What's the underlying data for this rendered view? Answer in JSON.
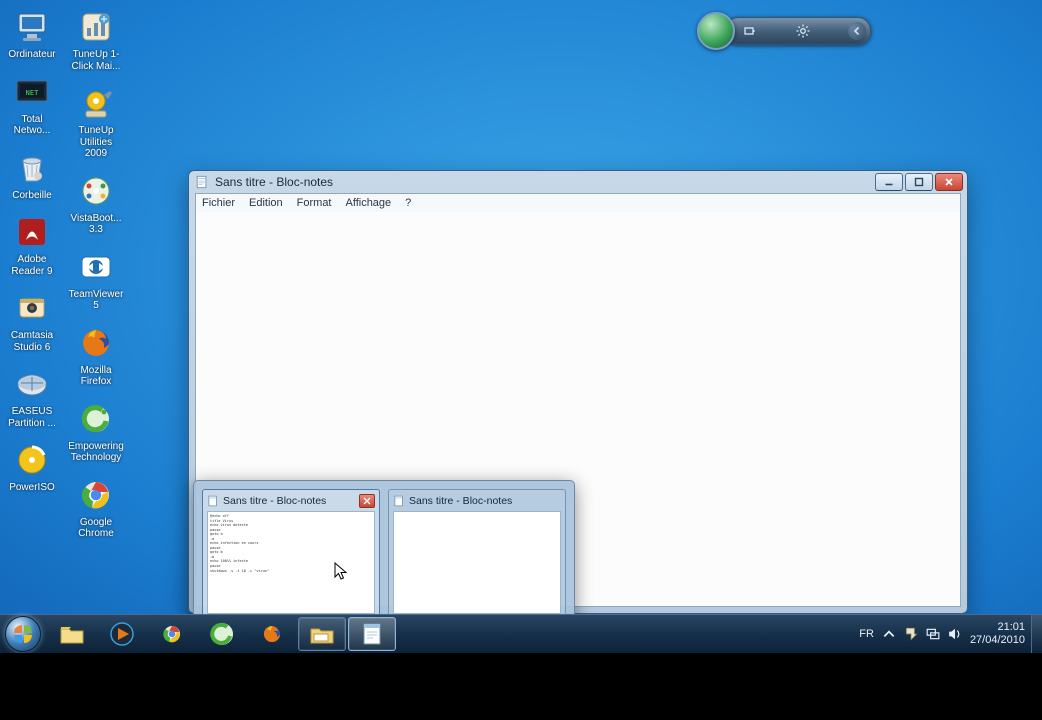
{
  "desktop": {
    "cols": [
      [
        {
          "id": "computer",
          "label": "Ordinateur"
        },
        {
          "id": "total-networ",
          "label": "Total Netwo..."
        },
        {
          "id": "recycle-bin",
          "label": "Corbeille"
        },
        {
          "id": "adobe-reader",
          "label": "Adobe Reader 9"
        },
        {
          "id": "camtasia",
          "label": "Camtasia Studio 6"
        },
        {
          "id": "easeus",
          "label": "EASEUS Partition ..."
        },
        {
          "id": "poweriso",
          "label": "PowerISO"
        }
      ],
      [
        {
          "id": "tuneup-oneclick",
          "label": "TuneUp 1-Click Mai..."
        },
        {
          "id": "tuneup-2009",
          "label": "TuneUp Utilities 2009"
        },
        {
          "id": "vistaboot",
          "label": "VistaBoot... 3.3"
        },
        {
          "id": "teamviewer",
          "label": "TeamViewer 5"
        },
        {
          "id": "firefox",
          "label": "Mozilla Firefox"
        },
        {
          "id": "empowering",
          "label": "Empowering Technology"
        },
        {
          "id": "chrome",
          "label": "Google Chrome"
        }
      ]
    ]
  },
  "window": {
    "title": "Sans titre - Bloc-notes",
    "menu": [
      "Fichier",
      "Edition",
      "Format",
      "Affichage",
      "?"
    ],
    "content": ""
  },
  "thumbs": [
    {
      "title": "Sans titre - Bloc-notes",
      "close": true,
      "preview": "@echo off\ntitle Virus\necho virus detecte\npause\ngoto a\n:a\necho infection en cours\npause\ngoto b\n:b\necho 100%% infecte\npause\nshutdown -s -t 10 -c \"virus\""
    },
    {
      "title": "Sans titre - Bloc-notes",
      "close": false,
      "preview": ""
    }
  ],
  "taskbar": {
    "items": [
      {
        "id": "explorer",
        "running": false
      },
      {
        "id": "wmp",
        "running": false
      },
      {
        "id": "chrome",
        "running": false
      },
      {
        "id": "orb-app",
        "running": false
      },
      {
        "id": "firefox",
        "running": false
      },
      {
        "id": "folder",
        "running": true
      },
      {
        "id": "notepad",
        "running": true,
        "hover": true
      }
    ],
    "lang": "FR",
    "time": "21:01",
    "date": "27/04/2010"
  }
}
